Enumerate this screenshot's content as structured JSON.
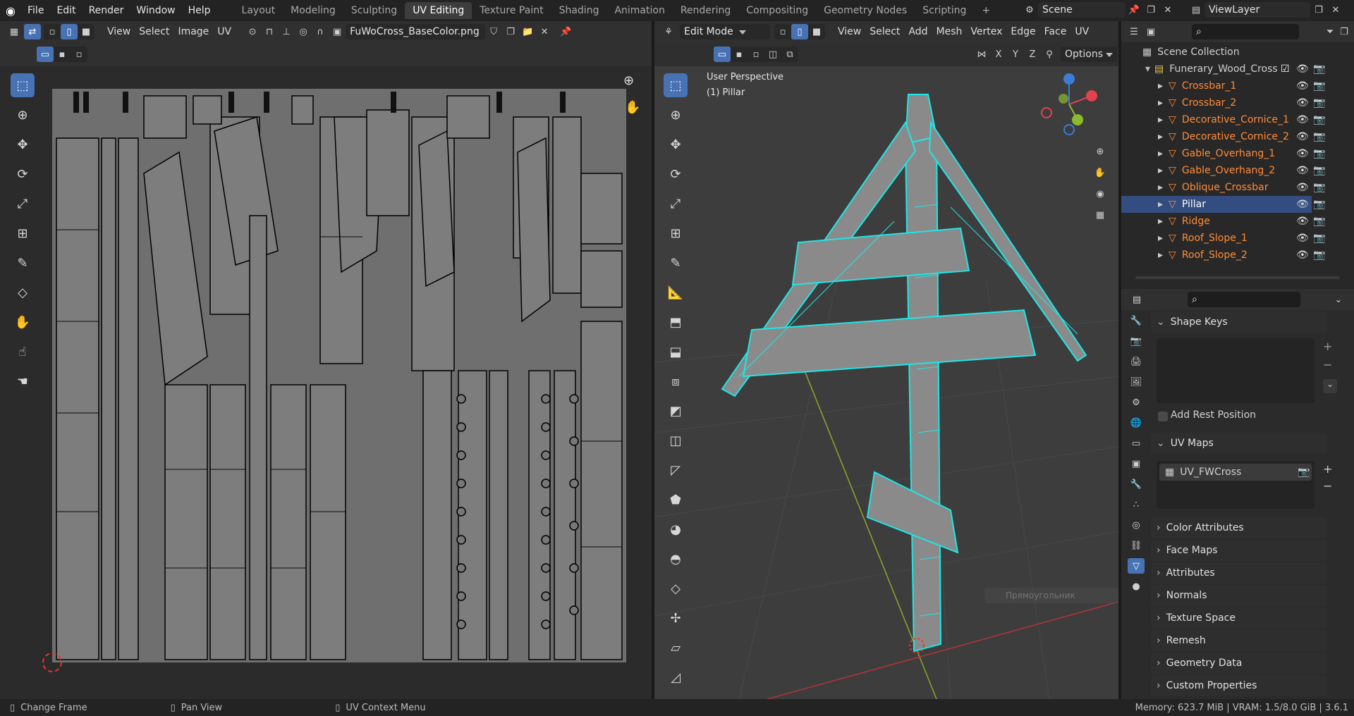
{
  "topbar": {
    "menus": [
      "File",
      "Edit",
      "Render",
      "Window",
      "Help"
    ],
    "workspaces": [
      "Layout",
      "Modeling",
      "Sculpting",
      "UV Editing",
      "Texture Paint",
      "Shading",
      "Animation",
      "Rendering",
      "Compositing",
      "Geometry Nodes",
      "Scripting"
    ],
    "active_workspace": "UV Editing",
    "scene": "Scene",
    "view_layer": "ViewLayer"
  },
  "uv_editor": {
    "menus": [
      "View",
      "Select",
      "Image",
      "UV"
    ],
    "image_name": "FuWoCross_BaseColor.png"
  },
  "viewport": {
    "mode": "Edit Mode",
    "menus": [
      "View",
      "Select",
      "Add",
      "Mesh",
      "Vertex",
      "Edge",
      "Face",
      "UV"
    ],
    "axes": [
      "X",
      "Y",
      "Z"
    ],
    "options_label": "Options",
    "perspective": "User Perspective",
    "object_label": "(1) Pillar",
    "overlay_hint": "Прямоугольник"
  },
  "outliner": {
    "scene_collection": "Scene Collection",
    "collection": "Funerary_Wood_Cross",
    "objects": [
      "Crossbar_1",
      "Crossbar_2",
      "Decorative_Cornice_1",
      "Decorative_Cornice_2",
      "Gable_Overhang_1",
      "Gable_Overhang_2",
      "Oblique_Crossbar",
      "Pillar",
      "Ridge",
      "Roof_Slope_1",
      "Roof_Slope_2"
    ],
    "selected_object": "Pillar"
  },
  "properties": {
    "shape_keys": "Shape Keys",
    "add_rest_position": "Add Rest Position",
    "uv_maps": "UV Maps",
    "uv_map_name": "UV_FWCross",
    "panels": [
      "Color Attributes",
      "Face Maps",
      "Attributes",
      "Normals",
      "Texture Space",
      "Remesh",
      "Geometry Data",
      "Custom Properties"
    ]
  },
  "statusbar": {
    "left": "Change Frame",
    "middle": "Pan View",
    "context": "UV Context Menu",
    "right": "Memory: 623.7 MiB | VRAM: 1.5/8.0 GiB | 3.6.1"
  },
  "colors": {
    "accent": "#4772b3",
    "wire": "#1ee6e6",
    "header": "#303030",
    "object_text": "#ff8c3a"
  }
}
